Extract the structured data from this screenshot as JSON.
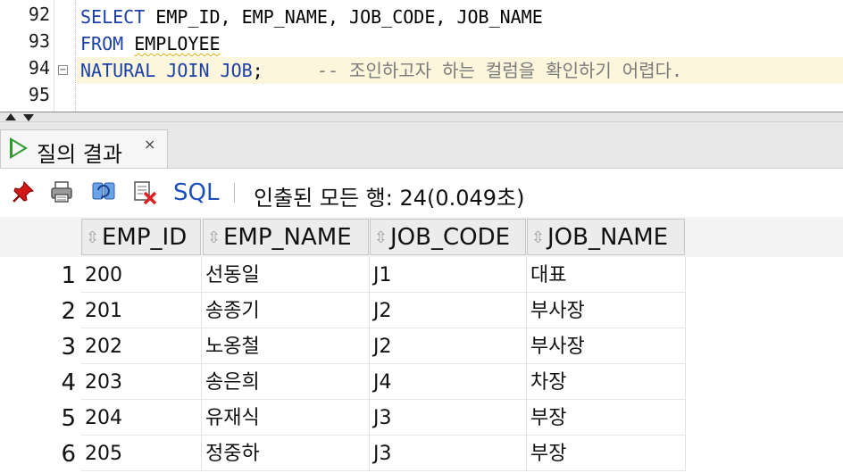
{
  "editor": {
    "line_numbers": [
      "92",
      "93",
      "94",
      "95"
    ],
    "lines": [
      {
        "kw": "SELECT",
        "rest": " EMP_ID, EMP_NAME, JOB_CODE, JOB_NAME"
      },
      {
        "kw": "FROM",
        "rest_squig": "EMPLOYEE"
      },
      {
        "kw": "NATURAL JOIN JOB",
        "rest": ";",
        "comment": "-- 조인하고자 하는 컬럼을 확인하기 어렵다."
      }
    ],
    "fold_marker": "−"
  },
  "results_tab": {
    "label": "질의 결과",
    "close": "×"
  },
  "toolbar": {
    "sql_label": "SQL",
    "status": "인출된 모든 행: 24(0.049초)"
  },
  "grid": {
    "columns": [
      "EMP_ID",
      "EMP_NAME",
      "JOB_CODE",
      "JOB_NAME"
    ],
    "sort_glyph": "⇳",
    "rows": [
      {
        "n": "1",
        "cells": [
          "200",
          "선동일",
          "J1",
          "대표"
        ]
      },
      {
        "n": "2",
        "cells": [
          "201",
          "송종기",
          "J2",
          "부사장"
        ]
      },
      {
        "n": "3",
        "cells": [
          "202",
          "노옹철",
          "J2",
          "부사장"
        ]
      },
      {
        "n": "4",
        "cells": [
          "203",
          "송은희",
          "J4",
          "차장"
        ]
      },
      {
        "n": "5",
        "cells": [
          "204",
          "유재식",
          "J3",
          "부장"
        ]
      },
      {
        "n": "6",
        "cells": [
          "205",
          "정중하",
          "J3",
          "부장"
        ]
      }
    ]
  },
  "colors": {
    "keyword": "#1b3fa8",
    "comment": "#7a7a7a",
    "current_line": "#fcf6dd",
    "run_icon": "#2f9a2f",
    "sql_link": "#1e4fb8"
  }
}
